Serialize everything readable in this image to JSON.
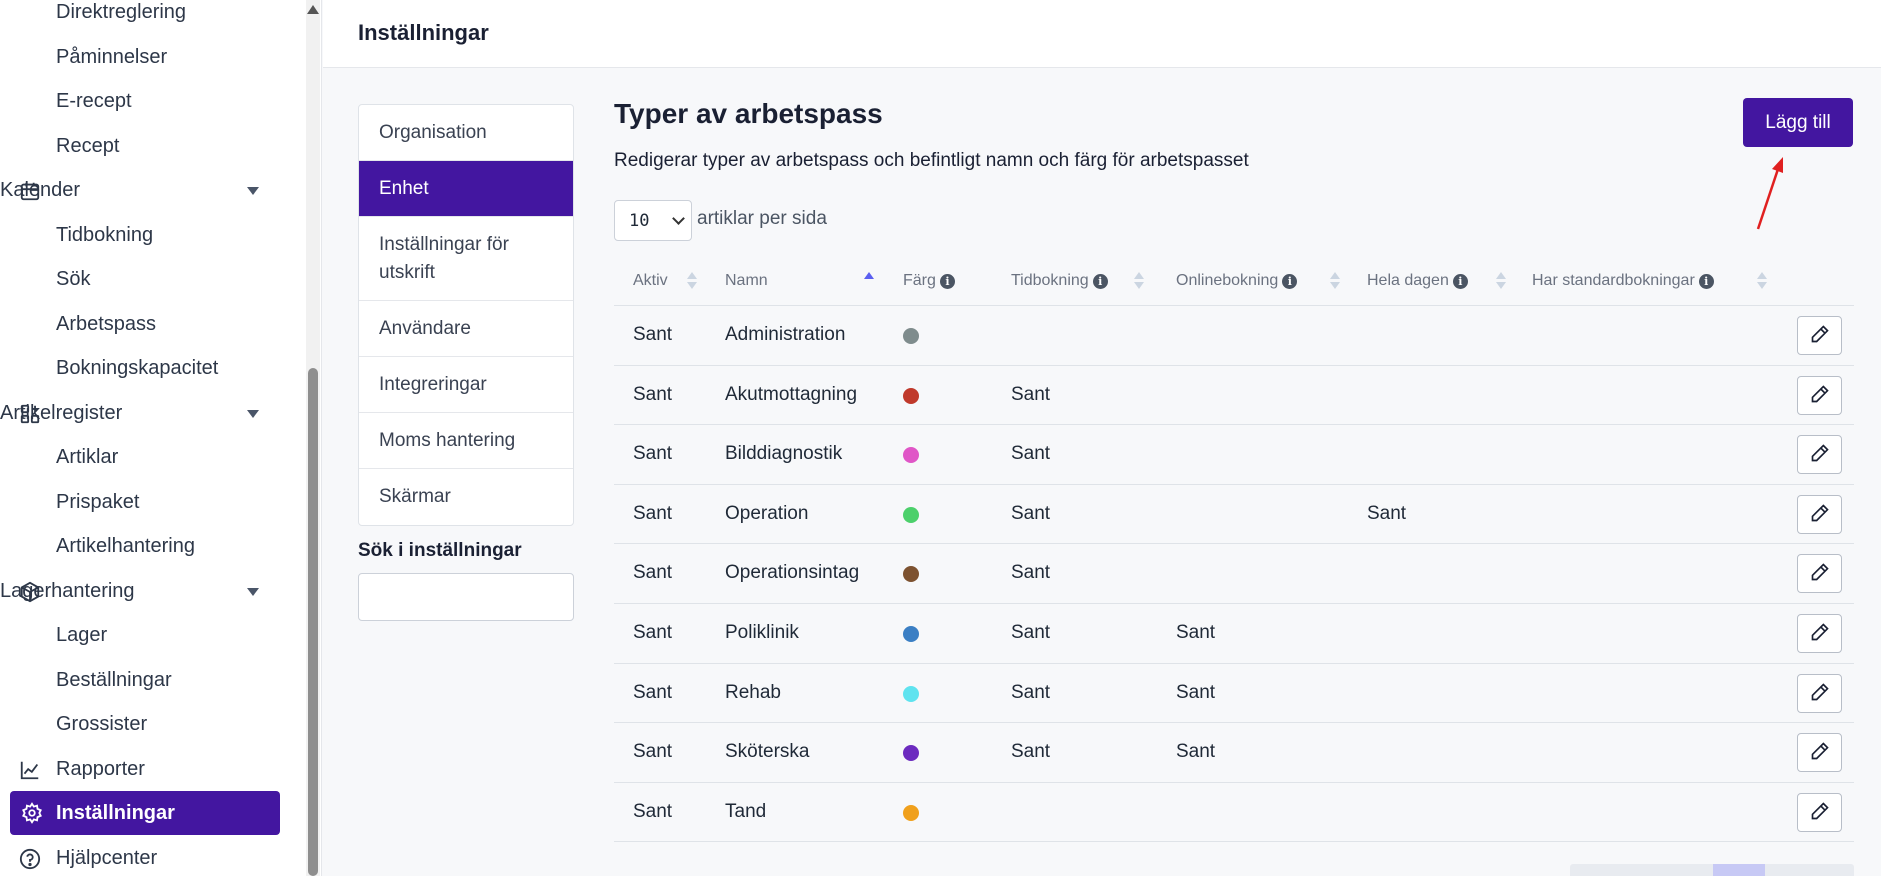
{
  "sidebar": {
    "items": [
      {
        "label": "Direktreglering",
        "type": "sub",
        "top": 0
      },
      {
        "label": "Påminnelser",
        "type": "sub"
      },
      {
        "label": "E-recept",
        "type": "sub"
      },
      {
        "label": "Recept",
        "type": "sub"
      },
      {
        "label": "Kalender",
        "type": "group",
        "icon": "calendar-icon"
      },
      {
        "label": "Tidbokning",
        "type": "sub"
      },
      {
        "label": "Sök",
        "type": "sub"
      },
      {
        "label": "Arbetspass",
        "type": "sub"
      },
      {
        "label": "Bokningskapacitet",
        "type": "sub"
      },
      {
        "label": "Artikelregister",
        "type": "group",
        "icon": "apps-icon"
      },
      {
        "label": "Artiklar",
        "type": "sub"
      },
      {
        "label": "Prispaket",
        "type": "sub"
      },
      {
        "label": "Artikelhantering",
        "type": "sub"
      },
      {
        "label": "Lagerhantering",
        "type": "group",
        "icon": "package-icon"
      },
      {
        "label": "Lager",
        "type": "sub"
      },
      {
        "label": "Beställningar",
        "type": "sub"
      },
      {
        "label": "Grossister",
        "type": "sub"
      },
      {
        "label": "Rapporter",
        "type": "top",
        "icon": "chart-line-icon"
      },
      {
        "label": "Inställningar",
        "type": "active",
        "icon": "gear-icon"
      },
      {
        "label": "Hjälpcenter",
        "type": "top",
        "icon": "help-circle-icon"
      }
    ]
  },
  "header": {
    "title": "Inställningar"
  },
  "settings_nav": {
    "items": [
      {
        "label": "Organisation",
        "active": false,
        "height": 56
      },
      {
        "label": "Enhet",
        "active": true,
        "height": 56
      },
      {
        "label": "Inställningar för utskrift",
        "active": false,
        "height": 84
      },
      {
        "label": "Användare",
        "active": false,
        "height": 56
      },
      {
        "label": "Integreringar",
        "active": false,
        "height": 56
      },
      {
        "label": "Moms hantering",
        "active": false,
        "height": 56
      },
      {
        "label": "Skärmar",
        "active": false,
        "height": 56
      }
    ],
    "search_label": "Sök i inställningar",
    "search_value": ""
  },
  "main": {
    "title": "Typer av arbetspass",
    "subtitle": "Redigerar typer av arbetspass och befintligt namn och färg för arbetspasset",
    "add_button": "Lägg till",
    "per_page_value": "10",
    "per_page_label": "artiklar per sida"
  },
  "table": {
    "columns": [
      {
        "label": "Aktiv",
        "info": false
      },
      {
        "label": "Namn",
        "info": false
      },
      {
        "label": "Färg",
        "info": true
      },
      {
        "label": "Tidbokning",
        "info": true
      },
      {
        "label": "Onlinebokning",
        "info": true
      },
      {
        "label": "Hela dagen",
        "info": true
      },
      {
        "label": "Har standardbokningar",
        "info": true
      }
    ],
    "rows": [
      {
        "aktiv": "Sant",
        "namn": "Administration",
        "color": "#7f8c8d",
        "tidbokning": "",
        "onlinebokning": "",
        "hela_dagen": ""
      },
      {
        "aktiv": "Sant",
        "namn": "Akutmottagning",
        "color": "#c0392b",
        "tidbokning": "Sant",
        "onlinebokning": "",
        "hela_dagen": ""
      },
      {
        "aktiv": "Sant",
        "namn": "Bilddiagnostik",
        "color": "#e056c7",
        "tidbokning": "Sant",
        "onlinebokning": "",
        "hela_dagen": ""
      },
      {
        "aktiv": "Sant",
        "namn": "Operation",
        "color": "#4cd06b",
        "tidbokning": "Sant",
        "onlinebokning": "",
        "hela_dagen": "Sant"
      },
      {
        "aktiv": "Sant",
        "namn": "Operationsintag",
        "color": "#7d5230",
        "tidbokning": "Sant",
        "onlinebokning": "",
        "hela_dagen": ""
      },
      {
        "aktiv": "Sant",
        "namn": "Poliklinik",
        "color": "#3b7fc4",
        "tidbokning": "Sant",
        "onlinebokning": "Sant",
        "hela_dagen": ""
      },
      {
        "aktiv": "Sant",
        "namn": "Rehab",
        "color": "#5fe3ef",
        "tidbokning": "Sant",
        "onlinebokning": "Sant",
        "hela_dagen": ""
      },
      {
        "aktiv": "Sant",
        "namn": "Sköterska",
        "color": "#6c2bbf",
        "tidbokning": "Sant",
        "onlinebokning": "Sant",
        "hela_dagen": ""
      },
      {
        "aktiv": "Sant",
        "namn": "Tand",
        "color": "#f0a01c",
        "tidbokning": "",
        "onlinebokning": "",
        "hela_dagen": ""
      }
    ]
  },
  "colors": {
    "accent": "#4316a0",
    "annotation_arrow": "#e02020"
  }
}
